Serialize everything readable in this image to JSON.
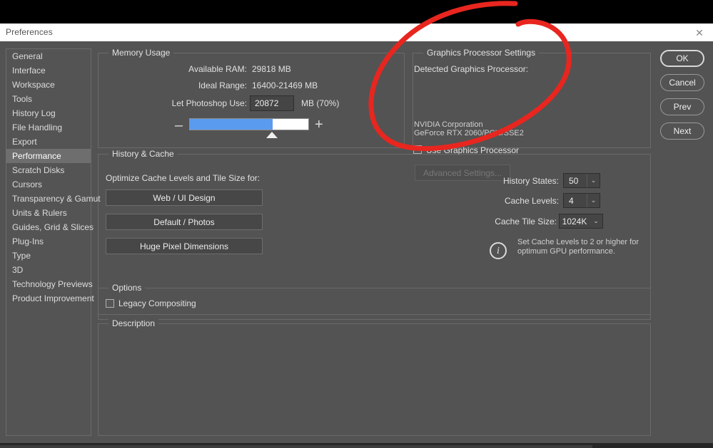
{
  "window": {
    "title": "Preferences",
    "close_icon": "✕"
  },
  "sidebar": {
    "items": [
      {
        "label": "General",
        "selected": false
      },
      {
        "label": "Interface",
        "selected": false
      },
      {
        "label": "Workspace",
        "selected": false
      },
      {
        "label": "Tools",
        "selected": false
      },
      {
        "label": "History Log",
        "selected": false
      },
      {
        "label": "File Handling",
        "selected": false
      },
      {
        "label": "Export",
        "selected": false
      },
      {
        "label": "Performance",
        "selected": true
      },
      {
        "label": "Scratch Disks",
        "selected": false
      },
      {
        "label": "Cursors",
        "selected": false
      },
      {
        "label": "Transparency & Gamut",
        "selected": false
      },
      {
        "label": "Units & Rulers",
        "selected": false
      },
      {
        "label": "Guides, Grid & Slices",
        "selected": false
      },
      {
        "label": "Plug-Ins",
        "selected": false
      },
      {
        "label": "Type",
        "selected": false
      },
      {
        "label": "3D",
        "selected": false
      },
      {
        "label": "Technology Previews",
        "selected": false
      },
      {
        "label": "Product Improvement",
        "selected": false
      }
    ]
  },
  "memory_usage": {
    "group_title": "Memory Usage",
    "available_ram_label": "Available RAM:",
    "available_ram_value": "29818 MB",
    "ideal_range_label": "Ideal Range:",
    "ideal_range_value": "16400-21469 MB",
    "let_photoshop_use_label": "Let Photoshop Use:",
    "let_photoshop_use_value": "20872",
    "unit_percent": "MB (70%)",
    "minus_label": "–",
    "plus_label": "+",
    "slider_percent": 70,
    "slider_fill_color": "#5a9bef"
  },
  "graphics_processor": {
    "group_title": "Graphics Processor Settings",
    "detected_label": "Detected Graphics Processor:",
    "vendor": "NVIDIA Corporation",
    "model": "GeForce RTX 2060/PCIe/SSE2",
    "use_gpu_label": "Use Graphics Processor",
    "use_gpu_checked": false,
    "advanced_settings_label": "Advanced Settings...",
    "advanced_settings_disabled": true
  },
  "history_cache": {
    "group_title": "History & Cache",
    "optimize_label": "Optimize Cache Levels and Tile Size for:",
    "presets": [
      "Web / UI Design",
      "Default / Photos",
      "Huge Pixel Dimensions"
    ],
    "history_states_label": "History States:",
    "history_states_value": "50",
    "cache_levels_label": "Cache Levels:",
    "cache_levels_value": "4",
    "cache_tile_size_label": "Cache Tile Size:",
    "cache_tile_size_value": "1024K",
    "dropdown_arrow": "⌄",
    "info_icon_glyph": "i",
    "info_text_line1": "Set Cache Levels to 2 or higher for",
    "info_text_line2": "optimum GPU performance."
  },
  "options": {
    "group_title": "Options",
    "legacy_compositing_label": "Legacy Compositing",
    "legacy_compositing_checked": false
  },
  "description": {
    "group_title": "Description",
    "body": ""
  },
  "action_buttons": [
    {
      "label": "OK",
      "primary": true
    },
    {
      "label": "Cancel",
      "primary": false
    },
    {
      "label": "Prev",
      "primary": false
    },
    {
      "label": "Next",
      "primary": false
    }
  ],
  "annotation": {
    "type": "hand-drawn-ellipse",
    "color": "#e8261f",
    "target": "Graphics Processor Settings"
  }
}
